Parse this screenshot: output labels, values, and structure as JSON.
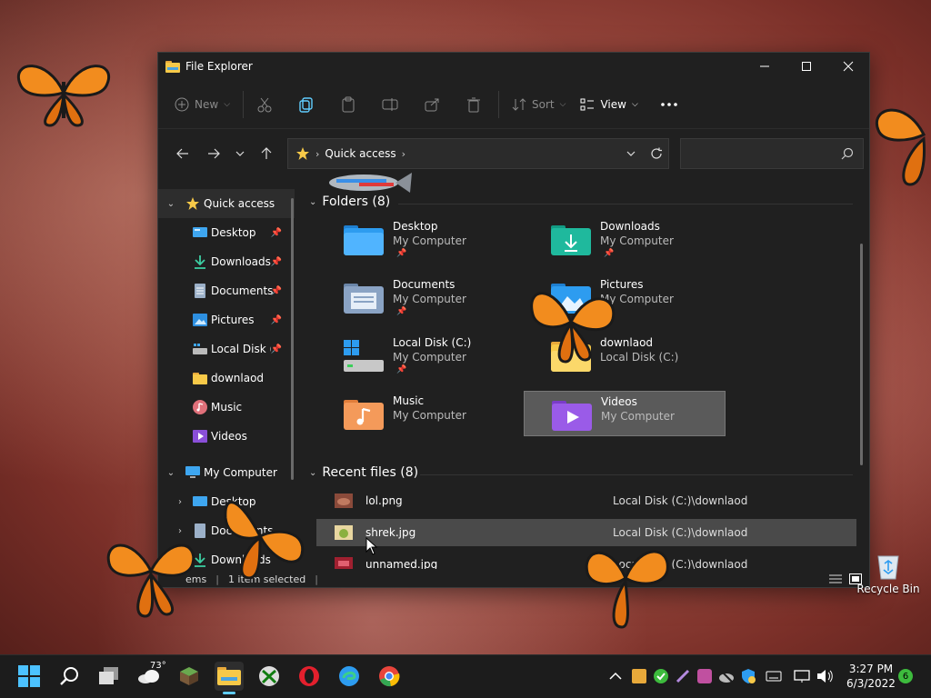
{
  "window": {
    "title": "File Explorer",
    "app_icon": "folder-icon"
  },
  "toolbar": {
    "new_label": "New",
    "sort_label": "Sort",
    "view_label": "View"
  },
  "address": {
    "crumb": "Quick access",
    "search_placeholder": ""
  },
  "sidebar": {
    "items": [
      {
        "label": "Quick access",
        "icon": "star-icon"
      },
      {
        "label": "Desktop",
        "icon": "desktop-icon"
      },
      {
        "label": "Downloads",
        "icon": "download-icon"
      },
      {
        "label": "Documents",
        "icon": "document-icon"
      },
      {
        "label": "Pictures",
        "icon": "pictures-icon"
      },
      {
        "label": "Local Disk (C:)",
        "icon": "drive-icon"
      },
      {
        "label": "downlaod",
        "icon": "folder-icon"
      },
      {
        "label": "Music",
        "icon": "music-icon"
      },
      {
        "label": "Videos",
        "icon": "videos-icon"
      },
      {
        "label": "My Computer",
        "icon": "computer-icon"
      },
      {
        "label": "Desktop",
        "icon": "desktop-icon"
      },
      {
        "label": "Documents",
        "icon": "document-icon"
      },
      {
        "label": "Downloads",
        "icon": "download-icon"
      }
    ]
  },
  "folders": {
    "heading": "Folders (8)",
    "items": [
      {
        "name": "Desktop",
        "location": "My Computer",
        "icon": "desktop-folder-icon"
      },
      {
        "name": "Downloads",
        "location": "My Computer",
        "icon": "downloads-folder-icon"
      },
      {
        "name": "Documents",
        "location": "My Computer",
        "icon": "documents-folder-icon"
      },
      {
        "name": "Pictures",
        "location": "My Computer",
        "icon": "pictures-folder-icon"
      },
      {
        "name": "Local Disk (C:)",
        "location": "My Computer",
        "icon": "drive-icon"
      },
      {
        "name": "downlaod",
        "location": "Local Disk (C:)",
        "icon": "folder-icon"
      },
      {
        "name": "Music",
        "location": "My Computer",
        "icon": "music-folder-icon"
      },
      {
        "name": "Videos",
        "location": "My Computer",
        "icon": "videos-folder-icon"
      }
    ]
  },
  "recent": {
    "heading": "Recent files (8)",
    "items": [
      {
        "name": "lol.png",
        "path": "Local Disk (C:)\\downlaod"
      },
      {
        "name": "shrek.jpg",
        "path": "Local Disk (C:)\\downlaod"
      },
      {
        "name": "unnamed.jpg",
        "path": "Local Disk (C:)\\downlaod"
      }
    ]
  },
  "status": {
    "items_text": "ems",
    "selected_text": "1 item selected"
  },
  "desktop": {
    "recycle_label": "Recycle Bin"
  },
  "taskbar": {
    "temperature": "73°",
    "time": "3:27 PM",
    "date": "6/3/2022",
    "notification_count": "6"
  },
  "colors": {
    "window_bg": "#202020",
    "accent": "#60cdff",
    "folder_yellow": "#f7c948",
    "selection": "#5a5a5a"
  }
}
